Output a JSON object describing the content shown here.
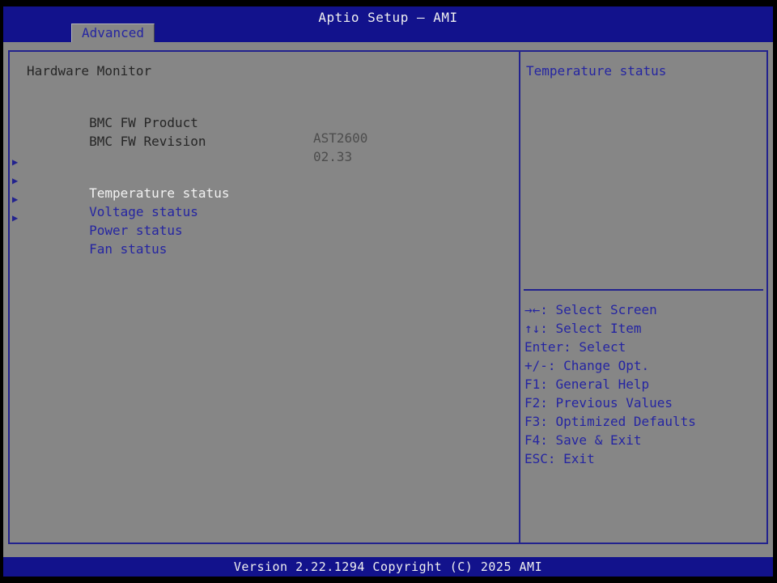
{
  "titlebar": {
    "title": "Aptio Setup – AMI"
  },
  "tab": {
    "label": "Advanced"
  },
  "main": {
    "section_title": "Hardware Monitor",
    "info_rows": [
      {
        "label": "BMC FW Product",
        "value": "AST2600"
      },
      {
        "label": "BMC FW Revision",
        "value": "02.33"
      }
    ],
    "menu_items": [
      {
        "label": "Temperature status",
        "selected": true
      },
      {
        "label": "Voltage status",
        "selected": false
      },
      {
        "label": "Power status",
        "selected": false
      },
      {
        "label": "Fan status",
        "selected": false
      }
    ]
  },
  "help": {
    "description": "Temperature status",
    "hints": [
      "→←: Select Screen",
      "↑↓: Select Item",
      "Enter: Select",
      "+/-: Change Opt.",
      "F1: General Help",
      "F2: Previous Values",
      "F3: Optimized Defaults",
      "F4: Save & Exit",
      "ESC: Exit"
    ]
  },
  "footer": {
    "text": "Version 2.22.1294 Copyright (C) 2025 AMI"
  },
  "icons": {
    "submenu_arrow": "▶"
  },
  "colors": {
    "header_blue": "#12128c",
    "background_gray": "#868686",
    "text_blue": "#2525a2",
    "border_blue": "#22228e",
    "label_dark": "#262626",
    "value_gray": "#4d4d4d",
    "selected_white": "#f2f2f2"
  }
}
